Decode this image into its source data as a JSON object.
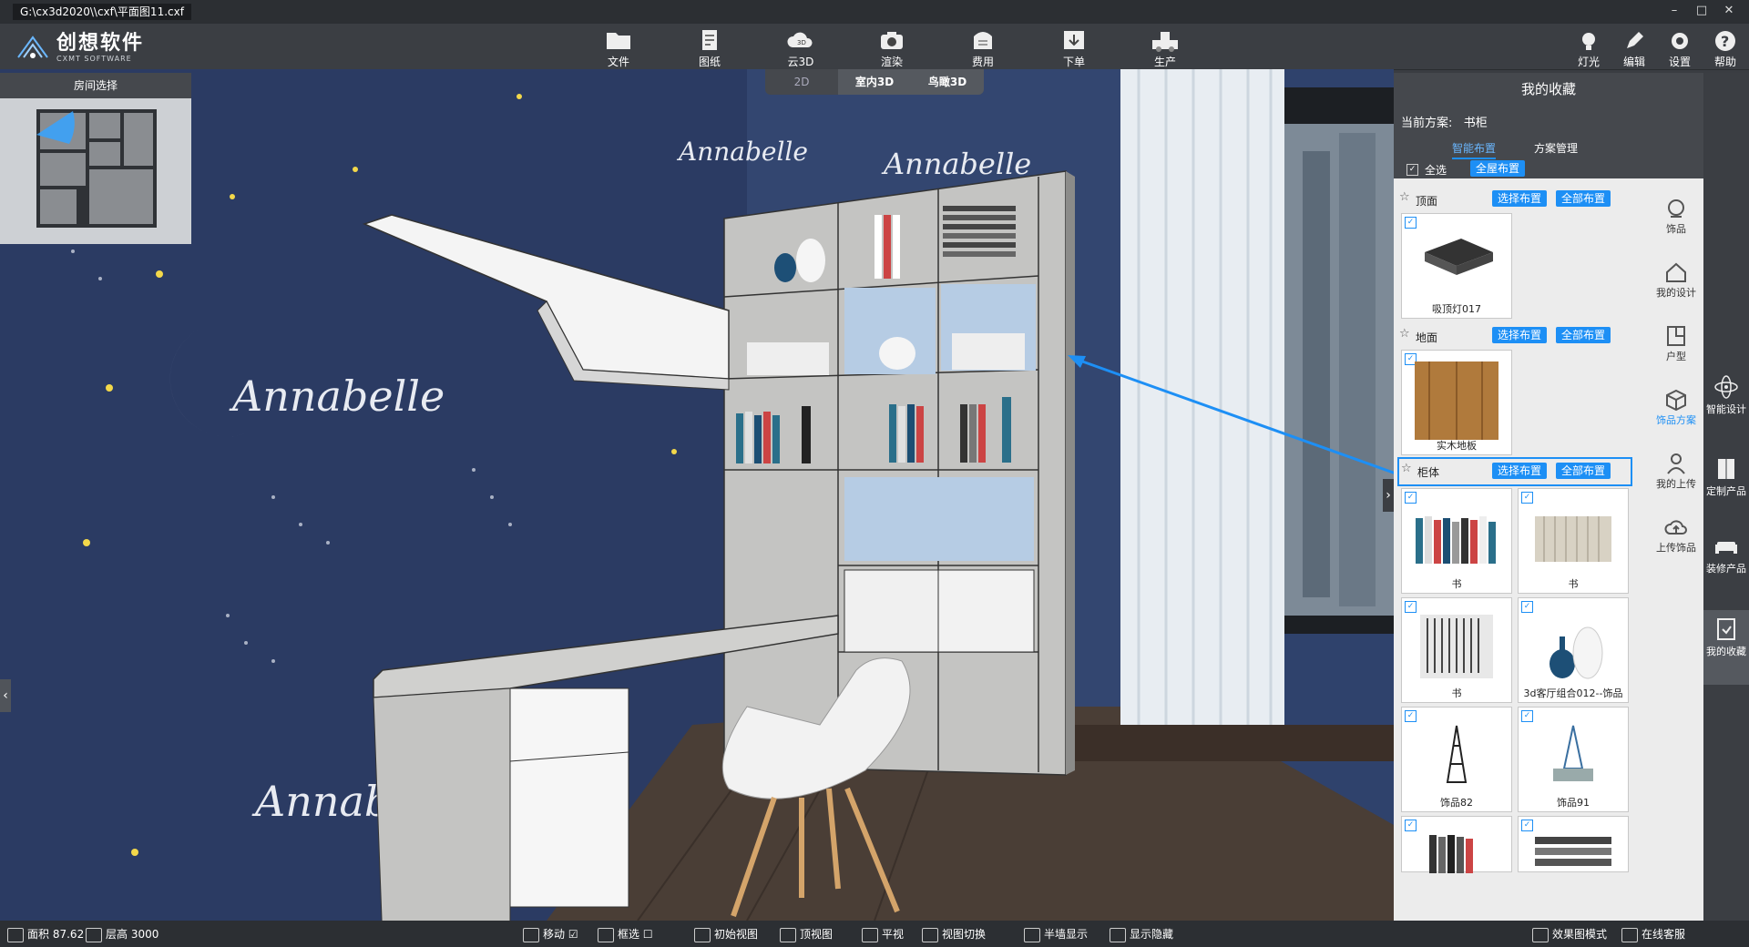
{
  "window": {
    "path": "G:\\cx3d2020\\\\cxf\\平面图11.cxf",
    "minimize": "–",
    "maximize": "□",
    "close": "✕"
  },
  "logo": {
    "cn": "创想软件",
    "en": "CXMT SOFTWARE"
  },
  "toolbar": {
    "items": [
      "文件",
      "图纸",
      "云3D",
      "渲染",
      "费用",
      "下单",
      "生产"
    ]
  },
  "toolbar_right": {
    "items": [
      "灯光",
      "编辑",
      "设置",
      "帮助"
    ]
  },
  "view_tabs": [
    "2D",
    "室内3D",
    "鸟瞰3D"
  ],
  "room_select": {
    "title": "房间选择"
  },
  "favorites": {
    "title": "我的收藏",
    "scheme_label": "当前方案:",
    "scheme_value": "书柜",
    "tabs": [
      "智能布置",
      "方案管理"
    ],
    "select_all": "全选",
    "whole_house": "全屋布置",
    "select_layout": "选择布置",
    "all_layout": "全部布置",
    "sections": [
      {
        "name": "顶面",
        "items": [
          "吸顶灯017"
        ]
      },
      {
        "name": "地面",
        "items": [
          "实木地板"
        ]
      },
      {
        "name": "柜体",
        "items": [
          "书",
          "书",
          "书",
          "3d客厅组合012--饰品",
          "饰品82",
          "饰品91",
          "",
          ""
        ]
      }
    ]
  },
  "icon_bar": [
    "饰品",
    "我的设计",
    "户型",
    "饰品方案",
    "我的上传",
    "上传饰品"
  ],
  "icon_bar_active": "饰品方案",
  "far_sidebar": [
    "智能设计",
    "定制产品",
    "装修产品",
    "我的收藏"
  ],
  "far_sidebar_active": "我的收藏",
  "status": {
    "area_label": "面积",
    "area_value": "87.62",
    "height_label": "层高",
    "height_value": "3000",
    "move": "移动",
    "box_select": "框选",
    "init_view": "初始视图",
    "top_view": "顶视图",
    "flat_view": "平视",
    "view_switch": "视图切换",
    "half_wall": "半墙显示",
    "show_hide": "显示隐藏",
    "render_mode": "效果图模式",
    "online_service": "在线客服"
  },
  "wallpaper_text": "Annabelle",
  "colors": {
    "accent": "#1d8ff5",
    "toolbar": "#3b3e43",
    "wallpaper": "#2b3b63"
  }
}
